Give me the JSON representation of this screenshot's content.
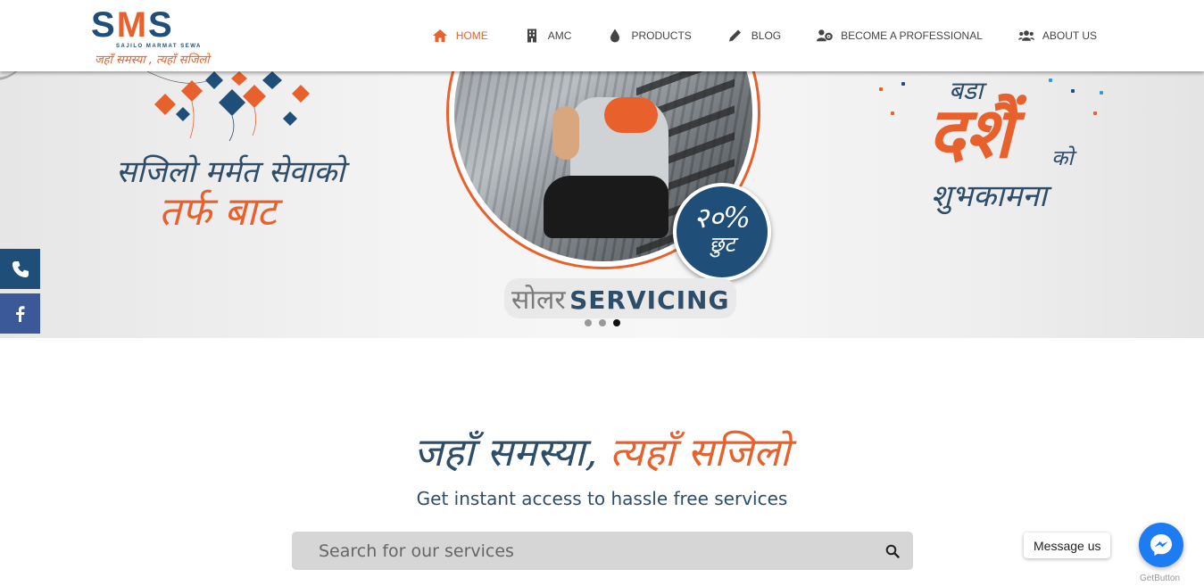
{
  "logo": {
    "main": "SMS",
    "sub": "SAJILO MARMAT SEWA",
    "tagline": "जहाँ समस्या , त्यहाँ सजिलो"
  },
  "nav": {
    "items": [
      {
        "label": "HOME",
        "icon": "home-icon",
        "active": true
      },
      {
        "label": "AMC",
        "icon": "building-icon",
        "active": false
      },
      {
        "label": "PRODUCTS",
        "icon": "drop-icon",
        "active": false
      },
      {
        "label": "BLOG",
        "icon": "pencil-icon",
        "active": false
      },
      {
        "label": "BECOME A PROFESSIONAL",
        "icon": "user-gear-icon",
        "active": false
      },
      {
        "label": "ABOUT US",
        "icon": "users-icon",
        "active": false
      }
    ]
  },
  "hero": {
    "left_line1": "सजिलो मर्मत सेवाको",
    "left_line2": "तर्फ बाट",
    "discount_pct": "२०%",
    "discount_word": "छुट",
    "solar_np": "सोलर",
    "solar_en": "SERVICING",
    "right_line1": "बडा",
    "right_line2": "दशैं",
    "right_line3": "को",
    "right_line4": "शुभकामना",
    "slides": 3,
    "active_slide": 3
  },
  "side": {
    "phone_icon": "phone-icon",
    "facebook_icon": "facebook-icon"
  },
  "content": {
    "slogan_a": "जहाँ समस्या,",
    "slogan_b": "त्यहाँ सजिलो",
    "subtitle": "Get instant access to hassle free services",
    "search_placeholder": "Search for our services"
  },
  "messenger": {
    "label": "Message us",
    "brand": "GetButton"
  },
  "colors": {
    "brand_blue": "#1f4e79",
    "brand_orange": "#e8612c",
    "facebook": "#3b5998",
    "messenger": "#1e7cf2"
  }
}
